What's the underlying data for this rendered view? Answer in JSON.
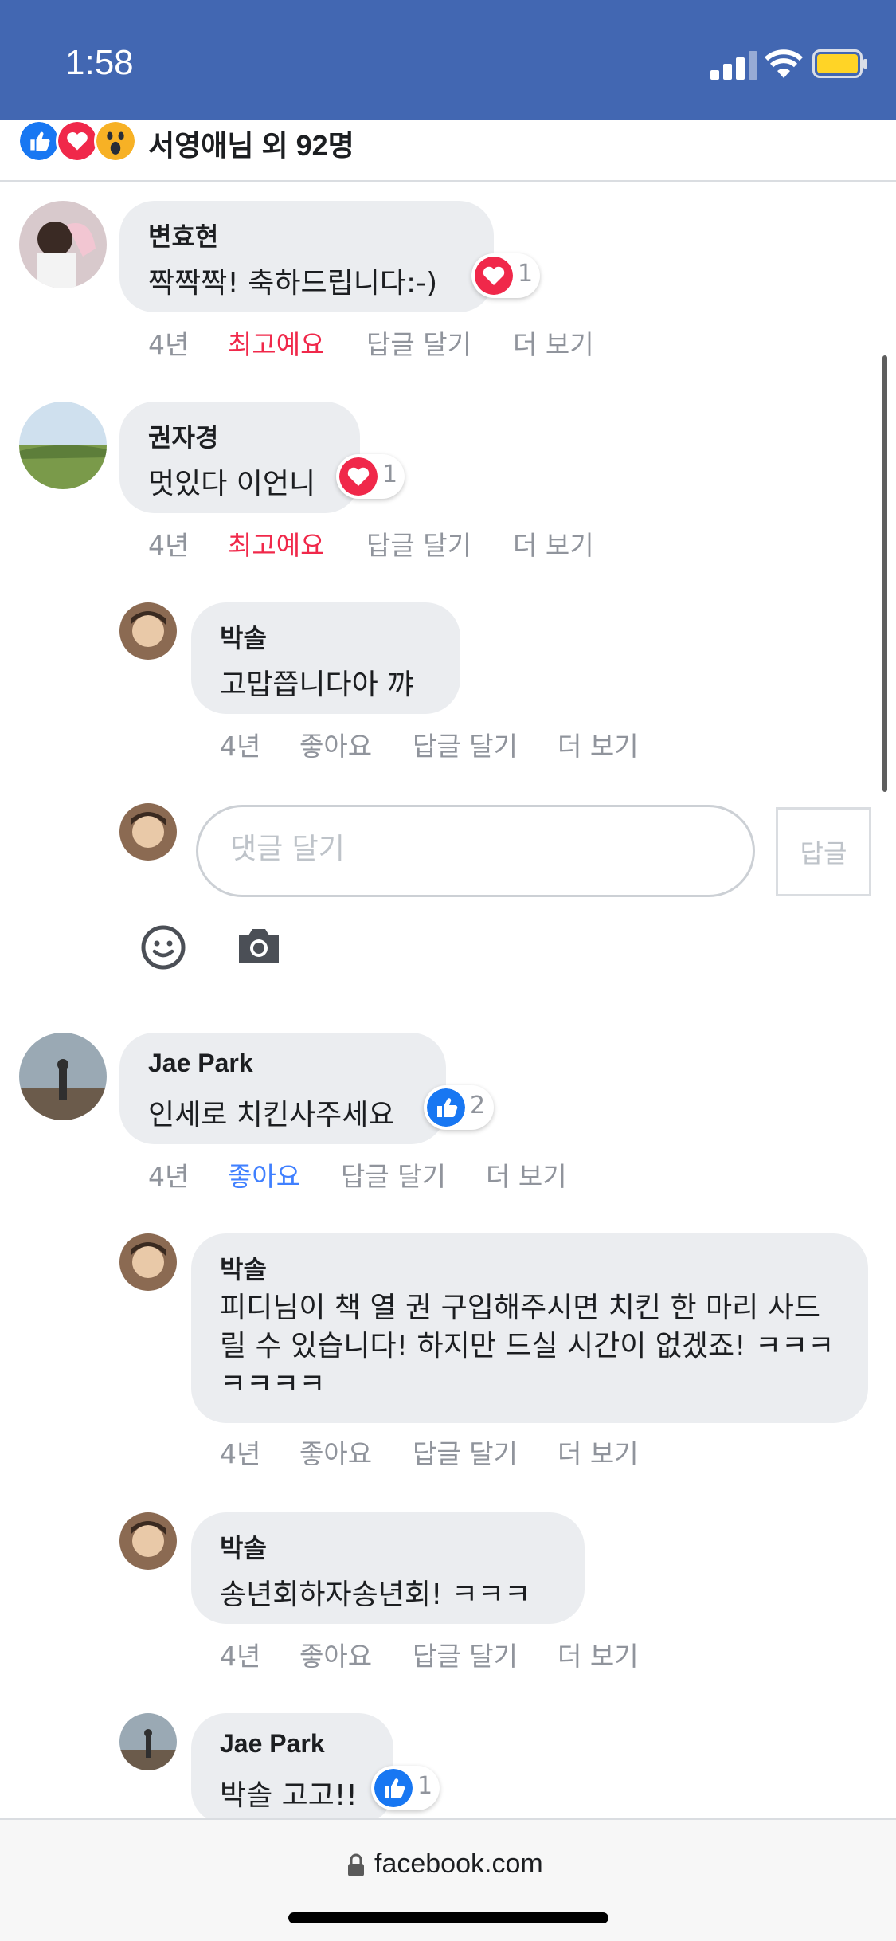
{
  "status": {
    "time": "1:58"
  },
  "reactions": {
    "summary": "서영애님 외 92명"
  },
  "comments": [
    {
      "author": "변효현",
      "text": "짝짝짝! 축하드립니다:-)",
      "reaction_count": "1",
      "time": "4년",
      "like_label": "최고예요",
      "reply_label": "답글 달기",
      "more_label": "더 보기"
    },
    {
      "author": "권자경",
      "text": "멋있다 이언니",
      "reaction_count": "1",
      "time": "4년",
      "like_label": "최고예요",
      "reply_label": "답글 달기",
      "more_label": "더 보기"
    },
    {
      "author": "박솔",
      "text": "고맙쯥니다아 꺄",
      "time": "4년",
      "like_label": "좋아요",
      "reply_label": "답글 달기",
      "more_label": "더 보기"
    },
    {
      "author": "Jae Park",
      "text": "인세로 치킨사주세요",
      "reaction_count": "2",
      "time": "4년",
      "like_label": "좋아요",
      "reply_label": "답글 달기",
      "more_label": "더 보기"
    },
    {
      "author": "박솔",
      "text": "피디님이 책 열 권 구입해주시면 치킨 한 마리 사드릴 수 있습니다! 하지만 드실 시간이 없겠죠! ㅋㅋㅋㅋㅋㅋㅋ",
      "time": "4년",
      "like_label": "좋아요",
      "reply_label": "답글 달기",
      "more_label": "더 보기"
    },
    {
      "author": "박솔",
      "text": "송년회하자송년회! ㅋㅋㅋ",
      "time": "4년",
      "like_label": "좋아요",
      "reply_label": "답글 달기",
      "more_label": "더 보기"
    },
    {
      "author": "Jae Park",
      "text": "박솔 고고!!",
      "reaction_count": "1"
    }
  ],
  "reply_box": {
    "placeholder": "댓글 달기",
    "submit_label": "답글"
  },
  "browser": {
    "url": "facebook.com"
  },
  "colors": {
    "header": "#4267b2",
    "love": "#f0284a",
    "like": "#4080ff",
    "bubble": "#ebedf0",
    "meta": "#90949c"
  }
}
